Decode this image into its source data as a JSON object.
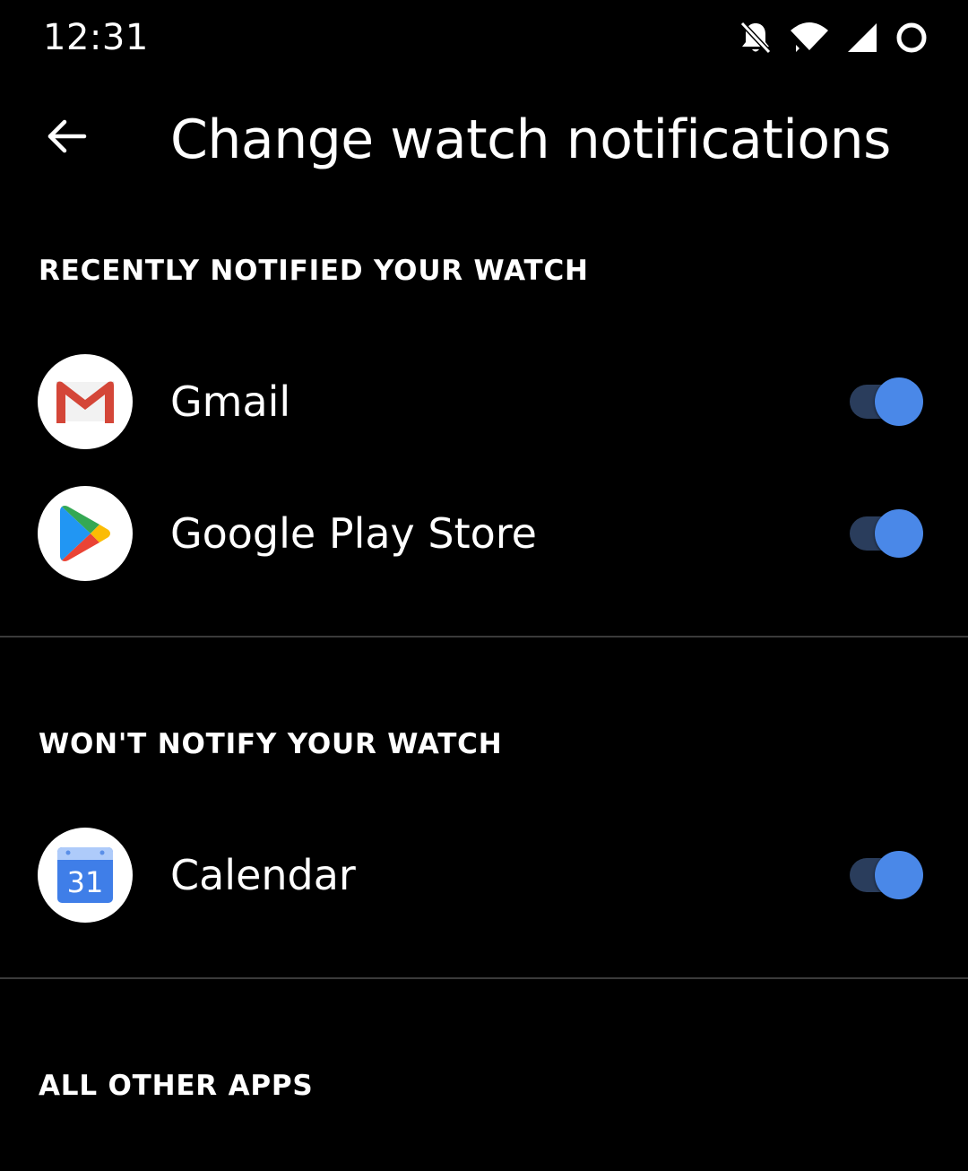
{
  "status_bar": {
    "time": "12:31",
    "icons": [
      "bell-off-icon",
      "wifi-icon",
      "cell-signal-icon",
      "battery-ring-icon"
    ]
  },
  "app_bar": {
    "back_icon": "arrow-left-icon",
    "title": "Change watch notifications"
  },
  "sections": {
    "recent": {
      "header": "RECENTLY NOTIFIED YOUR WATCH",
      "apps": [
        {
          "label": "Gmail",
          "icon": "gmail-icon",
          "enabled": true
        },
        {
          "label": "Google Play Store",
          "icon": "play-store-icon",
          "enabled": true
        }
      ]
    },
    "wont_notify": {
      "header": "WON'T NOTIFY YOUR WATCH",
      "apps": [
        {
          "label": "Calendar",
          "icon": "calendar-icon",
          "icon_text": "31",
          "enabled": true
        }
      ]
    },
    "all_other": {
      "header": "ALL OTHER APPS"
    }
  },
  "colors": {
    "background": "#000000",
    "toggle_thumb": "#4a88e8",
    "toggle_track": "#2a3d5c",
    "divider": "#3a3a3a"
  }
}
